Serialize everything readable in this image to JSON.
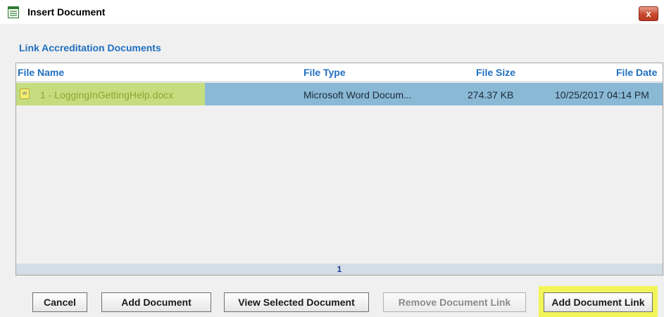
{
  "window": {
    "title": "Insert Document",
    "close_label": "x"
  },
  "section": {
    "title": "Link Accreditation Documents"
  },
  "grid": {
    "columns": {
      "file_name": "File Name",
      "file_type": "File Type",
      "file_size": "File Size",
      "file_date": "File Date"
    },
    "rows": [
      {
        "file_name": "1 - LoggingInGettingHelp.docx",
        "file_type": "Microsoft Word Docum...",
        "file_size": "274.37 KB",
        "file_date": "10/25/2017  04:14 PM"
      }
    ],
    "page": "1"
  },
  "buttons": {
    "cancel": "Cancel",
    "add_document": "Add Document",
    "view_selected": "View Selected Document",
    "remove_link": "Remove Document Link",
    "add_link": "Add Document Link"
  },
  "colors": {
    "accent_blue": "#1f6fc0",
    "selected_row": "#8ab9d6",
    "name_highlight": "#c5dd7f",
    "button_highlight": "#f2f558"
  }
}
